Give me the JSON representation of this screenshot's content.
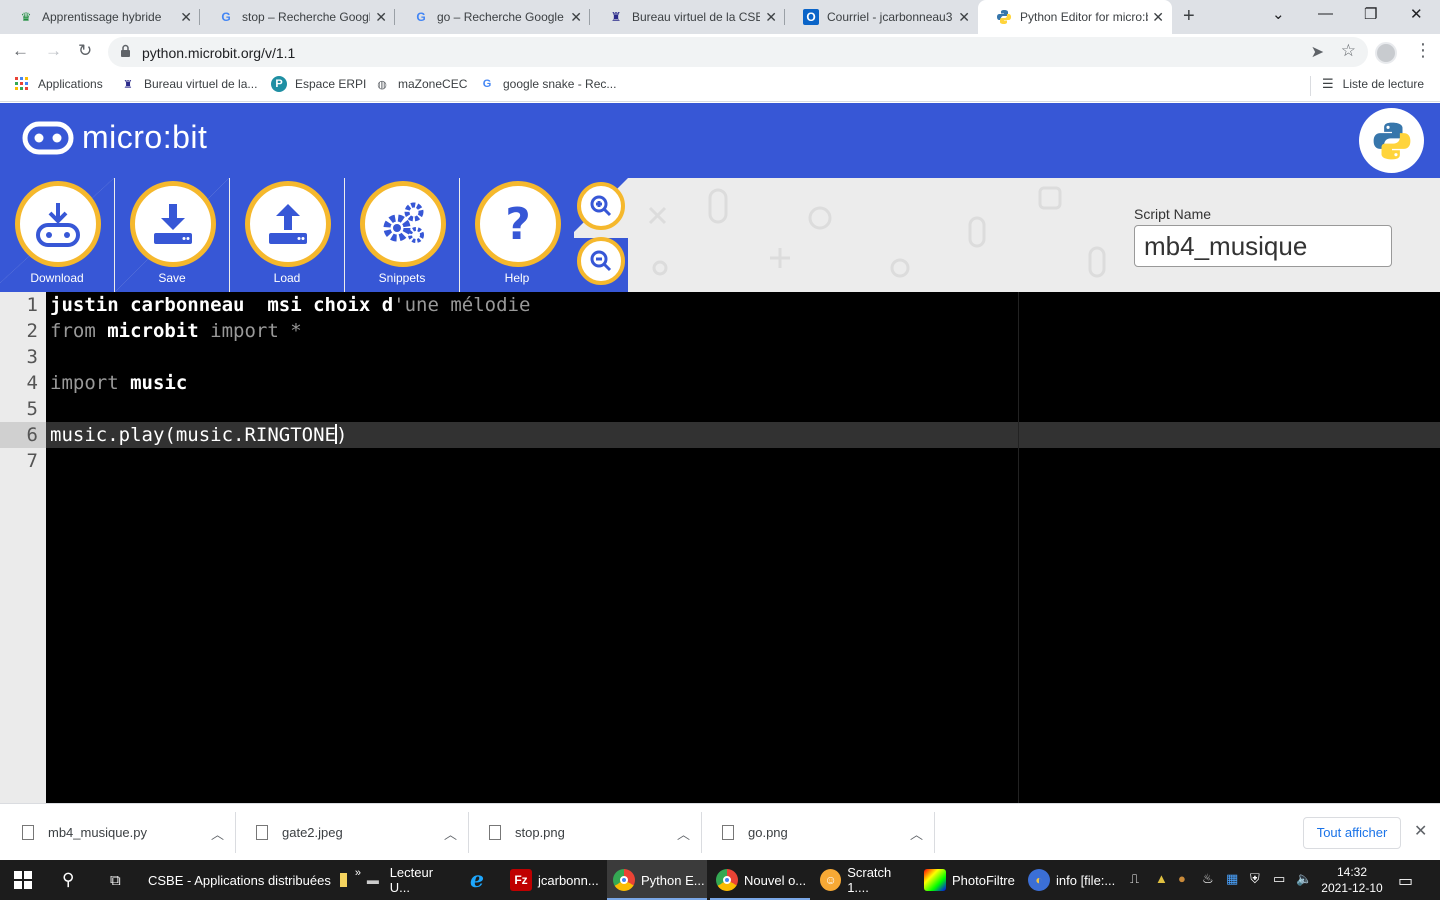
{
  "browser": {
    "tabs": [
      {
        "title": "Apprentissage hybride",
        "icon": "classroom-icon"
      },
      {
        "title": "stop – Recherche Google",
        "icon": "google-icon"
      },
      {
        "title": "go – Recherche Google",
        "icon": "google-icon"
      },
      {
        "title": "Bureau virtuel de la CSBE",
        "icon": "bureau-icon"
      },
      {
        "title": "Courriel - jcarbonneau3",
        "icon": "outlook-icon"
      },
      {
        "title": "Python Editor for micro:bit",
        "icon": "python-icon"
      }
    ],
    "url": "python.microbit.org/v/1.1",
    "bookmarks": [
      {
        "label": "Applications"
      },
      {
        "label": "Bureau virtuel de la..."
      },
      {
        "label": "Espace ERPI"
      },
      {
        "label": "maZoneCEC"
      },
      {
        "label": "google snake - Rec..."
      }
    ],
    "reading_list": "Liste de lecture"
  },
  "app": {
    "logo_text": "micro:bit",
    "toolbar": {
      "download": "Download",
      "save": "Save",
      "load": "Load",
      "snippets": "Snippets",
      "help": "Help"
    },
    "script_name_label": "Script Name",
    "script_name": "mb4_musique"
  },
  "editor": {
    "line_numbers": [
      "1",
      "2",
      "3",
      "4",
      "5",
      "6",
      "7"
    ],
    "active_line": 6
  },
  "downloads": {
    "items": [
      "mb4_musique.py",
      "gate2.jpeg",
      "stop.png",
      "go.png"
    ],
    "show_all": "Tout afficher"
  },
  "taskbar": {
    "items": [
      {
        "label": "CSBE - Applications distribuées"
      },
      {
        "label": "Lecteur U..."
      },
      {
        "label": "jcarbonn..."
      },
      {
        "label": "Python E..."
      },
      {
        "label": "Nouvel o..."
      },
      {
        "label": "Scratch 1...."
      },
      {
        "label": "PhotoFiltre"
      },
      {
        "label": "info [file:..."
      }
    ],
    "time": "14:32",
    "date": "2021-12-10"
  },
  "colors": {
    "microbit_blue": "#3757d6",
    "button_ring": "#f5b82d",
    "editor_bg": "#000000"
  }
}
